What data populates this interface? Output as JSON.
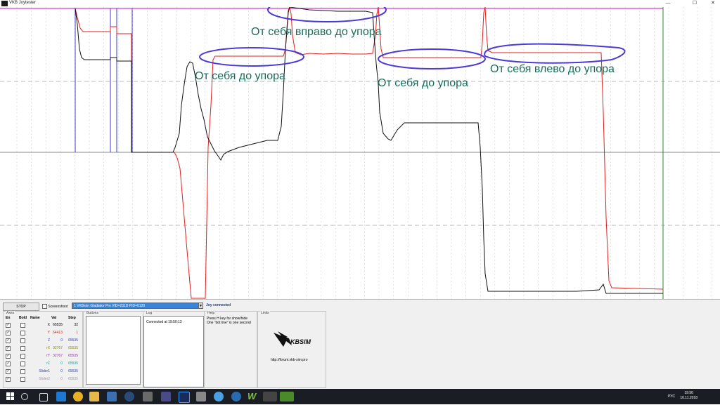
{
  "window": {
    "title": "VKB Joytester",
    "minimize": "—",
    "maximize": "☐",
    "close": "✕"
  },
  "annotations": [
    "От себя вправо до упора",
    "От себя до упора",
    "От себя до упора",
    "От себя влево до упора"
  ],
  "controls": {
    "stop": "STOP",
    "screenshot": "Screenshoot",
    "device": "1 VKBsim Gladiator Pro  VID=231D PID=0120",
    "status": "Joy connected"
  },
  "axes": {
    "title": "Axes",
    "headers": [
      "En",
      "Bold",
      "Name",
      "Val",
      "Step"
    ],
    "rows": [
      {
        "en": "✓",
        "name": "X",
        "val": "65535",
        "step": "32",
        "color": "#000000"
      },
      {
        "en": "✓",
        "name": "Y",
        "val": "64413",
        "step": "1",
        "color": "#e0201c"
      },
      {
        "en": "✓",
        "name": "Z",
        "val": "0",
        "step": "65535",
        "color": "#2a3fbf"
      },
      {
        "en": "✓",
        "name": "rX",
        "val": "32767",
        "step": "65535",
        "color": "#8a8a1a"
      },
      {
        "en": "✓",
        "name": "rY",
        "val": "32767",
        "step": "65535",
        "color": "#9b2bb0"
      },
      {
        "en": "✓",
        "name": "rZ",
        "val": "0",
        "step": "65535",
        "color": "#1f9a96"
      },
      {
        "en": "✓",
        "name": "Slider1",
        "val": "0",
        "step": "65535",
        "color": "#2a3fbf"
      },
      {
        "en": "✓",
        "name": "Slider2",
        "val": "0",
        "step": "65535",
        "color": "#9a9a9a"
      }
    ]
  },
  "buttons_group": {
    "title": "Buttons"
  },
  "log_group": {
    "title": "Log",
    "text": "Connected at 19:50:12"
  },
  "help_group": {
    "title": "Help",
    "line1": "Press H key for show/hide",
    "line2": "One \"dot line\" is one second"
  },
  "links_group": {
    "title": "Links",
    "logo_text": "KBSIM",
    "url": "http://forum.vkb-sim.pro"
  },
  "taskbar": {
    "lang": "РУС",
    "time": "19:50",
    "date": "10.11.2018"
  }
}
